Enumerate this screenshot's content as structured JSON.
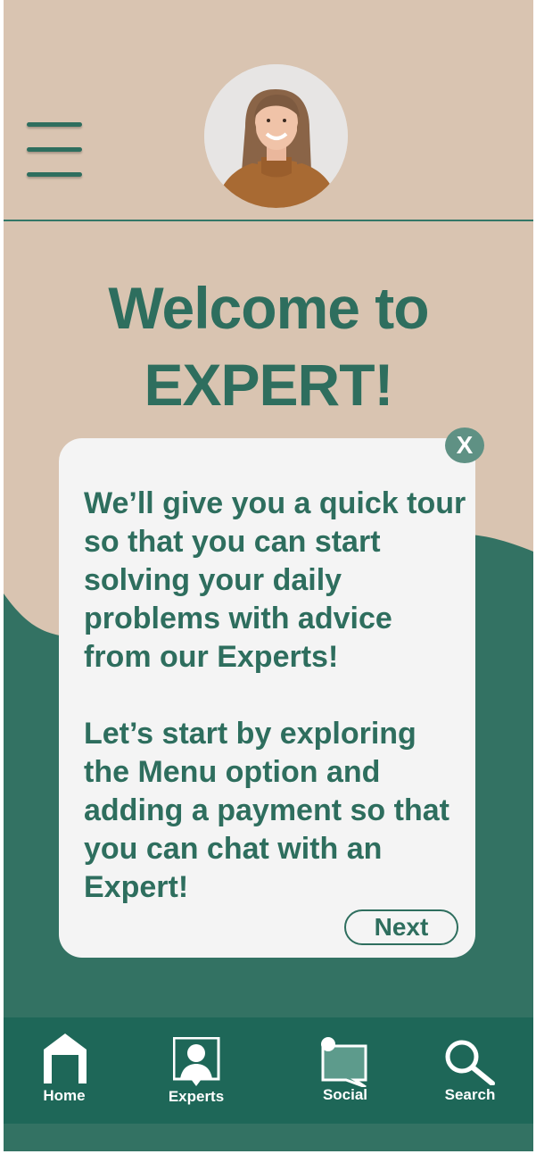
{
  "header": {
    "menu_icon": "hamburger-menu-icon",
    "avatar_icon": "user-avatar"
  },
  "welcome": {
    "line1": "Welcome to",
    "line2": "EXPERT!"
  },
  "tour_card": {
    "close_label": "X",
    "paragraph1": "We’ll give you a quick tour so that you can start solving your daily problems with advice from our Experts!",
    "paragraph2": "Let’s start by exploring the Menu option and adding a payment so that you can chat with an Expert!",
    "next_label": "Next"
  },
  "bottom_nav": {
    "items": [
      {
        "label": "Home",
        "icon": "home-icon"
      },
      {
        "label": "Experts",
        "icon": "experts-icon"
      },
      {
        "label": "Social",
        "icon": "social-chat-icon"
      },
      {
        "label": "Search",
        "icon": "search-icon"
      }
    ]
  },
  "colors": {
    "background": "#d9c4b1",
    "primary_green": "#2e6e5e",
    "nav_green": "#1e6758",
    "card": "#f4f4f4"
  }
}
